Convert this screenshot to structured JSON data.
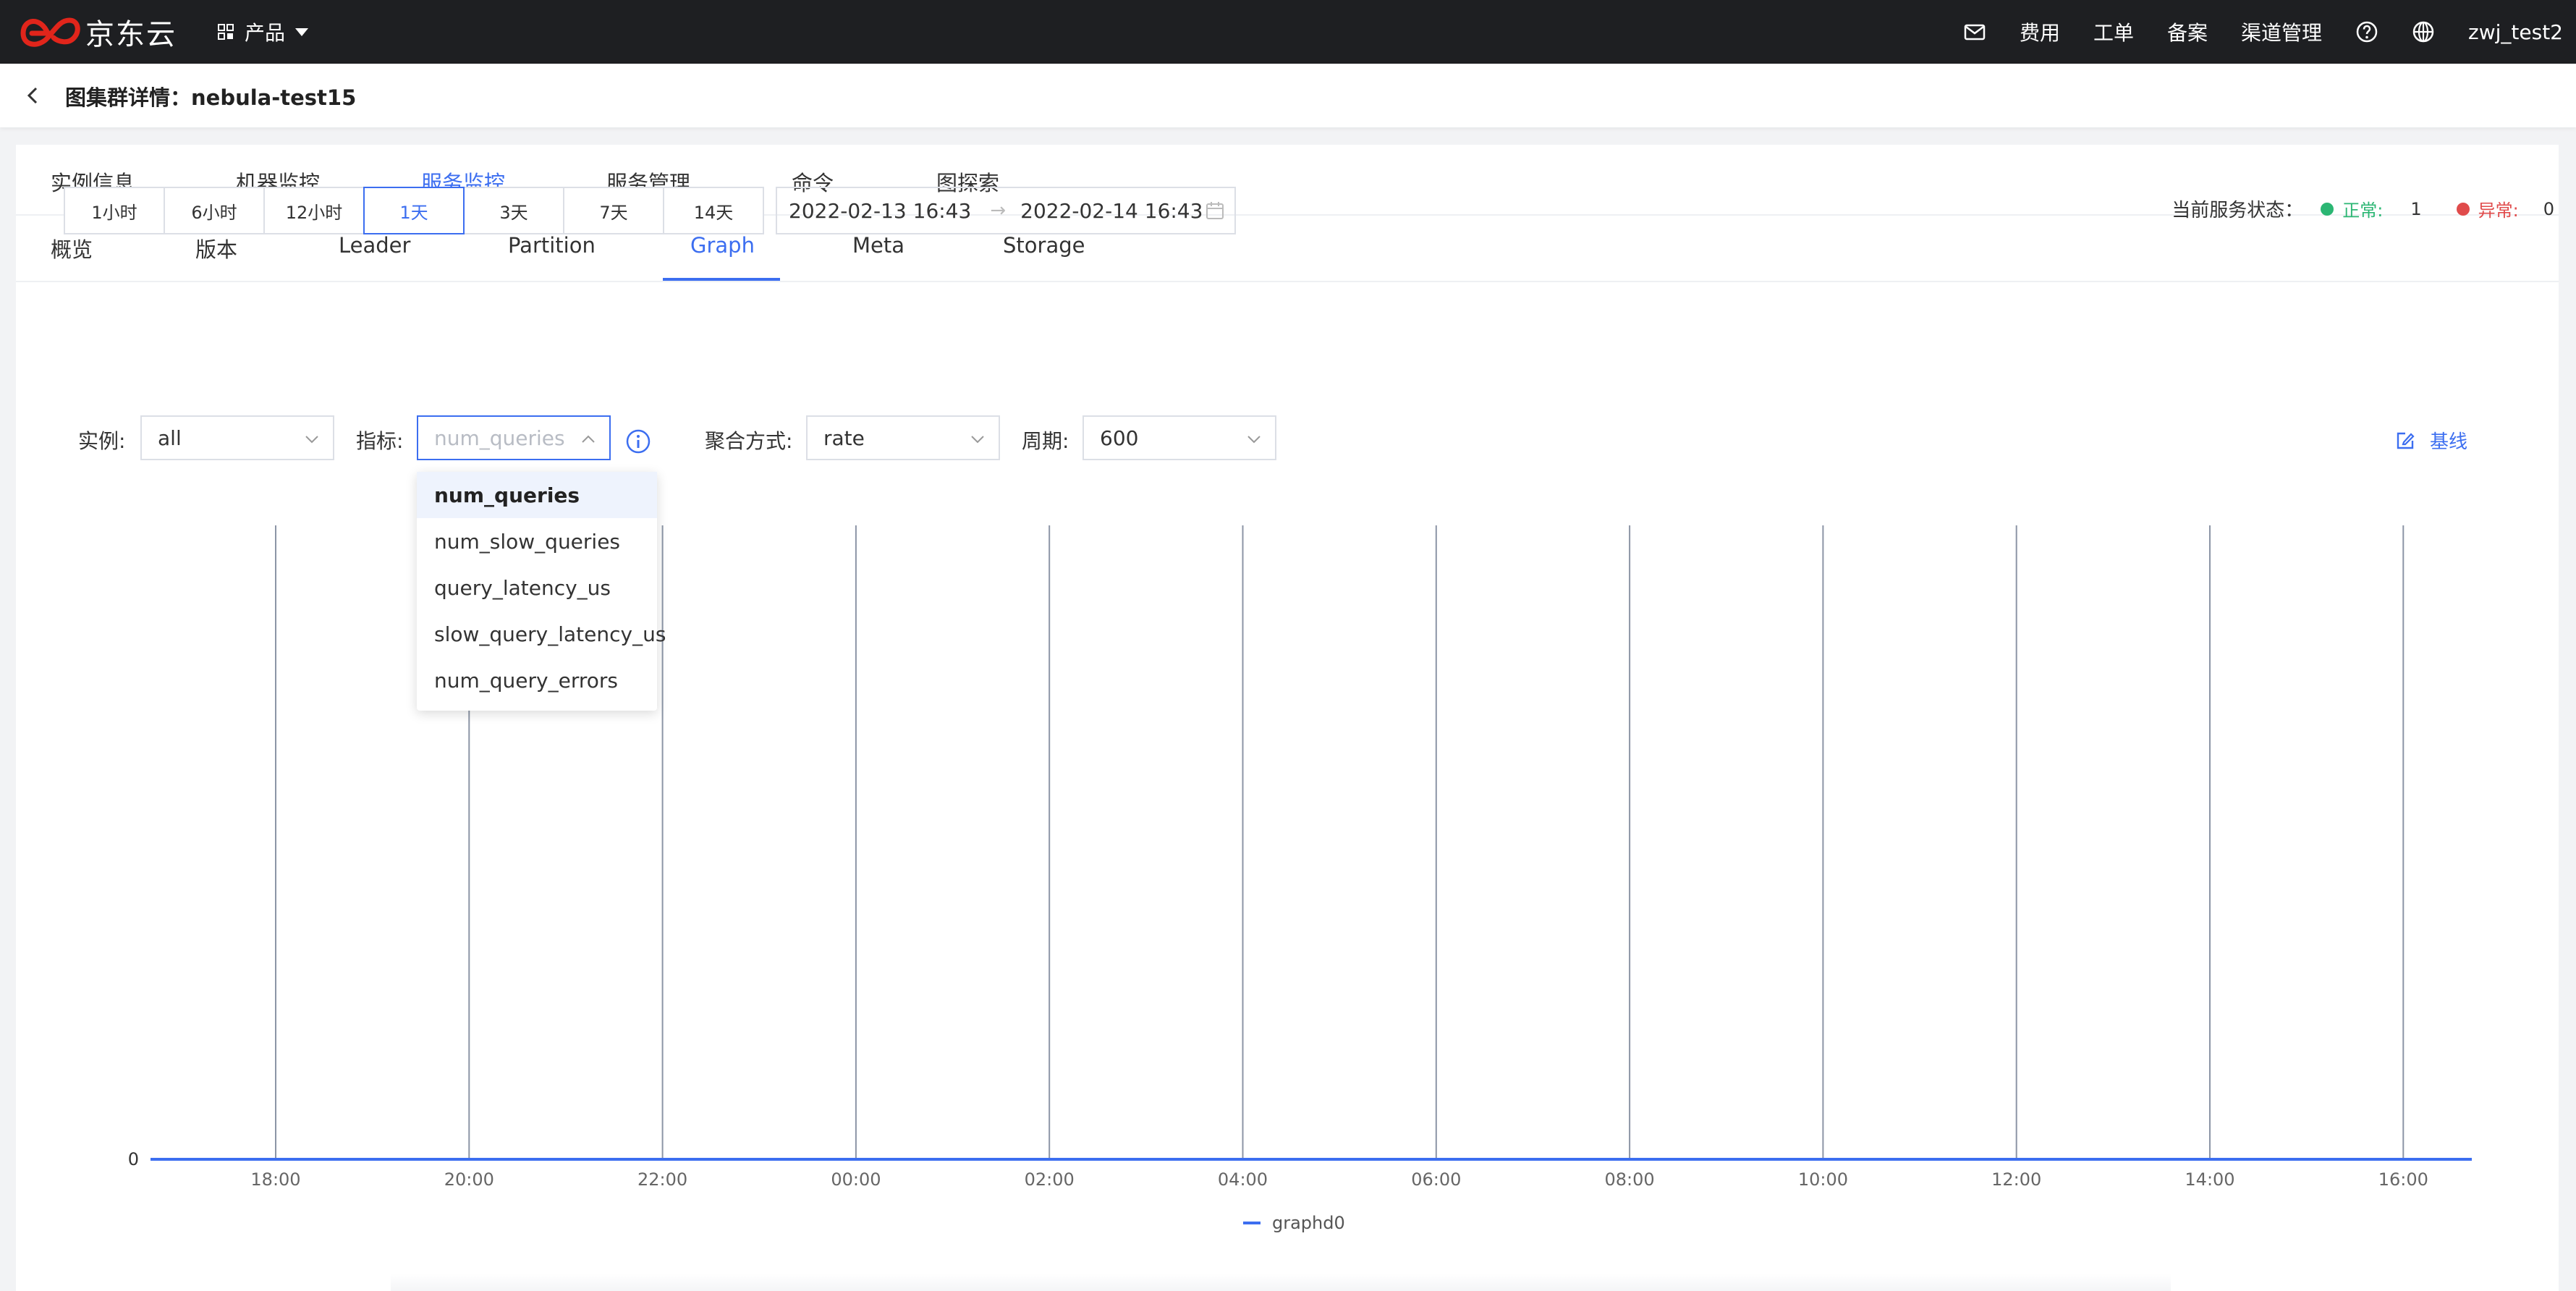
{
  "topnav": {
    "logo_text": "京东云",
    "product_menu_label": "产品",
    "items": [
      {
        "label": "费用"
      },
      {
        "label": "工单"
      },
      {
        "label": "备案"
      },
      {
        "label": "渠道管理"
      }
    ],
    "username": "zwj_test2",
    "icons": [
      "mail-icon",
      "help-icon",
      "globe-icon"
    ]
  },
  "header": {
    "title": "图集群详情：nebula-test15"
  },
  "main_tabs": [
    {
      "label": "实例信息"
    },
    {
      "label": "机器监控"
    },
    {
      "label": "服务监控",
      "active": true
    },
    {
      "label": "服务管理"
    },
    {
      "label": "命令"
    },
    {
      "label": "图探索"
    }
  ],
  "sub_tabs": [
    {
      "label": "概览"
    },
    {
      "label": "版本"
    },
    {
      "label": "Leader"
    },
    {
      "label": "Partition"
    },
    {
      "label": "Graph",
      "active": true
    },
    {
      "label": "Meta"
    },
    {
      "label": "Storage"
    }
  ],
  "time_ranges": [
    {
      "label": "1小时"
    },
    {
      "label": "6小时"
    },
    {
      "label": "12小时"
    },
    {
      "label": "1天",
      "active": true
    },
    {
      "label": "3天"
    },
    {
      "label": "7天"
    },
    {
      "label": "14天"
    }
  ],
  "date_range": {
    "start": "2022-02-13 16:43",
    "separator": "→",
    "end": "2022-02-14 16:43"
  },
  "service_status": {
    "label": "当前服务状态：",
    "ok_label": "正常:",
    "ok_count": "1",
    "error_label": "异常:",
    "error_count": "0",
    "ok_color": "#2bb673",
    "error_color": "#e04b4b"
  },
  "filters": {
    "instance_label": "实例:",
    "instance_value": "all",
    "metric_label": "指标:",
    "metric_placeholder": "num_queries",
    "aggregation_label": "聚合方式:",
    "aggregation_value": "rate",
    "period_label": "周期:",
    "period_value": "600",
    "baseline_label": "基线"
  },
  "metric_options": [
    {
      "label": "num_queries",
      "selected": true
    },
    {
      "label": "num_slow_queries"
    },
    {
      "label": "query_latency_us"
    },
    {
      "label": "slow_query_latency_us"
    },
    {
      "label": "num_query_errors"
    }
  ],
  "accent_color": "#3c6ef0",
  "chart_data": {
    "type": "line",
    "x": [
      "18:00",
      "20:00",
      "22:00",
      "00:00",
      "02:00",
      "04:00",
      "06:00",
      "08:00",
      "10:00",
      "12:00",
      "14:00",
      "16:00"
    ],
    "y_ticks": [
      "0"
    ],
    "series": [
      {
        "name": "graphd0",
        "values": [
          0,
          0,
          0,
          0,
          0,
          0,
          0,
          0,
          0,
          0,
          0,
          0
        ],
        "color": "#3c6ef0"
      }
    ],
    "legend_position": "bottom",
    "grid": "vertical"
  }
}
